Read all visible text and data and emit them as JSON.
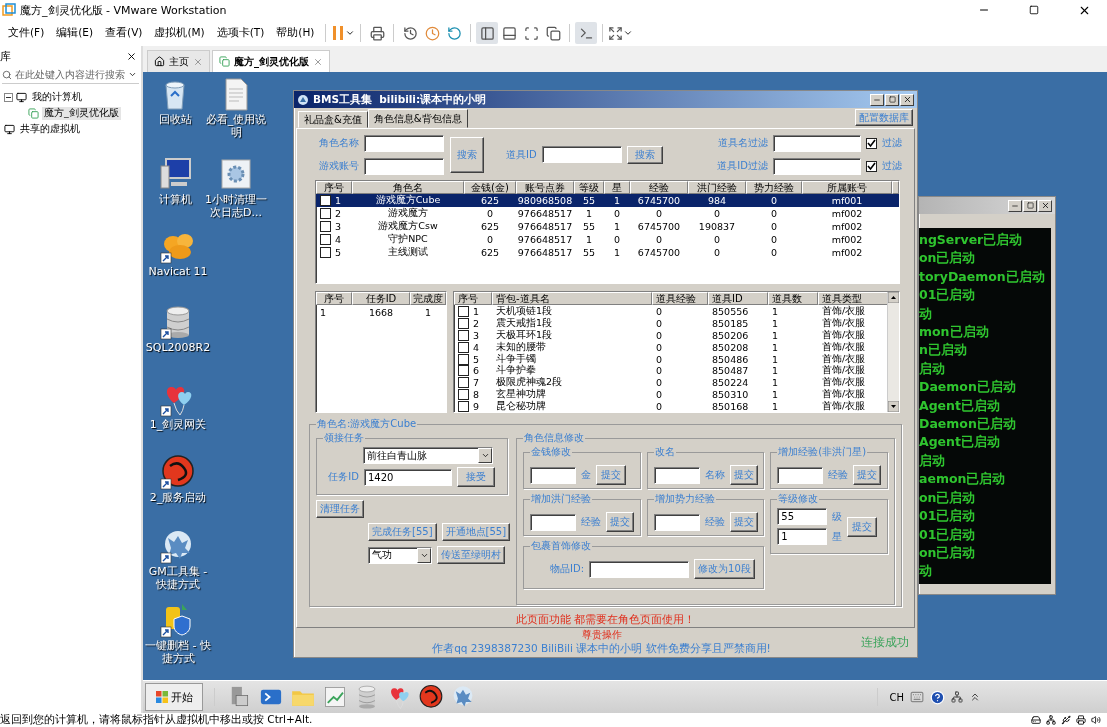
{
  "app": {
    "title": "魔方_剑灵优化版 - VMware Workstation",
    "menus": [
      "文件(F)",
      "编辑(E)",
      "查看(V)",
      "虚拟机(M)",
      "选项卡(T)",
      "帮助(H)"
    ]
  },
  "library": {
    "title": "库",
    "search": {
      "placeholder": "在此处键入内容进行搜索"
    },
    "tree": [
      {
        "label": "我的计算机",
        "expanded": true,
        "selected": false,
        "children": [
          {
            "label": "魔方_剑灵优化版",
            "selected": true
          }
        ]
      },
      {
        "label": "共享的虚拟机",
        "selected": false
      }
    ]
  },
  "tabs": [
    {
      "label": "主页",
      "selected": false
    },
    {
      "label": "魔方_剑灵优化版",
      "selected": true
    }
  ],
  "desktop_icons": [
    {
      "label": "回收站",
      "kind": "recycle",
      "shortcut": false
    },
    {
      "label": "必看_使用说明",
      "kind": "document",
      "shortcut": false
    },
    {
      "label": "计算机",
      "kind": "computer",
      "shortcut": false
    },
    {
      "label": "1小时清理一次日志D...",
      "kind": "gear",
      "shortcut": false
    },
    {
      "label": "Navicat 11",
      "kind": "flower",
      "shortcut": true
    },
    {
      "label": "SQL2008R2",
      "kind": "database",
      "shortcut": true
    },
    {
      "label": "1_剑灵网关",
      "kind": "hearts",
      "shortcut": true
    },
    {
      "label": "2_服务启动",
      "kind": "disc",
      "shortcut": true
    },
    {
      "label": "GM工具集 - 快捷方式",
      "kind": "pattern",
      "shortcut": true
    },
    {
      "label": "一键删档 - 快捷方式",
      "kind": "shield",
      "shortcut": true
    }
  ],
  "console": {
    "lines": [
      "ngServer已启动",
      "on已启动",
      "toryDaemon已启动",
      "01已启动",
      "动",
      "mon已启动",
      "n已启动",
      "启动",
      "Daemon已启动",
      "Agent已启动",
      "Daemon已启动",
      "Agent已启动",
      "启动",
      "aemon已启动",
      "on已启动",
      "01已启动",
      "01已启动",
      "on已启动",
      "动"
    ]
  },
  "tool": {
    "title": "BMS工具集  bilibili:课本中的小明",
    "tabs": [
      {
        "label": "礼品盒&充值",
        "selected": false
      },
      {
        "label": "角色信息&背包信息",
        "selected": true
      }
    ],
    "config_button": "配置数据库",
    "search": {
      "role_name_label": "角色名称",
      "account_label": "游戏账号",
      "search_button": "搜索",
      "item_id_label": "道具ID",
      "item_search_button": "搜索",
      "filters": [
        {
          "label": "道具名过滤",
          "check_label": "过滤",
          "checked": true
        },
        {
          "label": "道具ID过滤",
          "check_label": "过滤",
          "checked": true
        }
      ]
    },
    "roles": {
      "columns": [
        "序号",
        "角色名",
        "金钱(金)",
        "账号点券",
        "等级",
        "星",
        "经验",
        "洪门经验",
        "势力经验",
        "所属账号"
      ],
      "rows": [
        {
          "selected": true,
          "checked": false,
          "cells": [
            "1",
            "游戏魔方Cube",
            "625",
            "980968508",
            "55",
            "1",
            "6745700",
            "984",
            "0",
            "mf001"
          ]
        },
        {
          "selected": false,
          "checked": false,
          "cells": [
            "2",
            "游戏魔方",
            "0",
            "976648517",
            "1",
            "0",
            "0",
            "0",
            "0",
            "mf002"
          ]
        },
        {
          "selected": false,
          "checked": false,
          "cells": [
            "3",
            "游戏魔方Csw",
            "625",
            "976648517",
            "55",
            "1",
            "6745700",
            "190837",
            "0",
            "mf002"
          ]
        },
        {
          "selected": false,
          "checked": false,
          "cells": [
            "4",
            "守护NPC",
            "0",
            "976648517",
            "1",
            "0",
            "0",
            "0",
            "0",
            "mf002"
          ]
        },
        {
          "selected": false,
          "checked": false,
          "cells": [
            "5",
            "主线测试",
            "625",
            "976648517",
            "55",
            "1",
            "6745700",
            "0",
            "0",
            "mf002"
          ]
        }
      ]
    },
    "tasks": {
      "columns": [
        "序号",
        "任务ID",
        "完成度"
      ],
      "rows": [
        {
          "cells": [
            "1",
            "1668",
            "1"
          ]
        }
      ]
    },
    "bag": {
      "columns": [
        "序号",
        "背包-道具名",
        "道具经验",
        "道具ID",
        "道具数",
        "道具类型"
      ],
      "rows": [
        {
          "checked": false,
          "cells": [
            "1",
            "天机项链1段",
            "0",
            "850556",
            "1",
            "首饰/衣服"
          ]
        },
        {
          "checked": false,
          "cells": [
            "2",
            "震天戒指1段",
            "0",
            "850185",
            "1",
            "首饰/衣服"
          ]
        },
        {
          "checked": false,
          "cells": [
            "3",
            "天极耳环1段",
            "0",
            "850206",
            "1",
            "首饰/衣服"
          ]
        },
        {
          "checked": false,
          "cells": [
            "4",
            "未知的腰带",
            "0",
            "850208",
            "1",
            "首饰/衣服"
          ]
        },
        {
          "checked": false,
          "cells": [
            "5",
            "斗争手镯",
            "0",
            "850486",
            "1",
            "首饰/衣服"
          ]
        },
        {
          "checked": false,
          "cells": [
            "6",
            "斗争护拳",
            "0",
            "850487",
            "1",
            "首饰/衣服"
          ]
        },
        {
          "checked": false,
          "cells": [
            "7",
            "极限虎神魂2段",
            "0",
            "850224",
            "1",
            "首饰/衣服"
          ]
        },
        {
          "checked": false,
          "cells": [
            "8",
            "玄星神功牌",
            "0",
            "850310",
            "1",
            "首饰/衣服"
          ]
        },
        {
          "checked": false,
          "cells": [
            "9",
            "昆仑秘功牌",
            "0",
            "850168",
            "1",
            "首饰/衣服"
          ]
        }
      ]
    },
    "role_group": {
      "title": "角色名:游戏魔方Cube",
      "quest": {
        "title": "领接任务",
        "destination": "前往白青山脉",
        "task_id_label": "任务ID",
        "task_id": "1420",
        "accept_button": "接受"
      },
      "clear_button": "清理任务",
      "complete_button": "完成任务[55]",
      "unlock_button": "开通地点[55]",
      "skill_select": "气功",
      "teleport_button": "传送至绿明村",
      "edit": {
        "title": "角色信息修改",
        "money": {
          "title": "金钱修改",
          "unit": "金",
          "submit": "提交"
        },
        "rename": {
          "title": "改名",
          "unit": "名称",
          "submit": "提交"
        },
        "exp": {
          "title": "增加经验(非洪门星)",
          "unit": "经验",
          "submit": "提交"
        },
        "hongmen": {
          "title": "增加洪门经验",
          "unit": "经验",
          "submit": "提交"
        },
        "force": {
          "title": "增加势力经验",
          "unit": "经验",
          "submit": "提交"
        },
        "level": {
          "title": "等级修改",
          "level": "55",
          "level_unit": "级",
          "star": "1",
          "star_unit": "星",
          "submit": "提交"
        },
        "jewelry": {
          "title": "包裹首饰修改",
          "label": "物品ID:",
          "button": "修改为10段"
        }
      }
    },
    "notice": "此页面功能 都需要在角色页面使用！",
    "footer": {
      "warning": "尊贵操作",
      "credit": "作者qq 2398387230 BiliBili 课本中的小明  软件免费分享且严禁商用!",
      "status": "连接成功"
    }
  },
  "taskbar": {
    "start": "开始",
    "lang": "CH"
  },
  "status_bar": "返回到您的计算机，请将鼠标指针从虚拟机中移出或按 Ctrl+Alt."
}
